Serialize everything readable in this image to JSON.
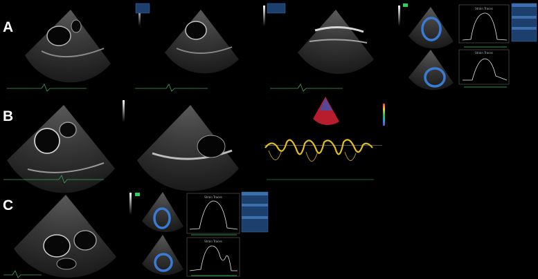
{
  "panel_labels": {
    "a": "A",
    "b": "B",
    "c": "C"
  },
  "strain_titles": {
    "a_top": "Strain Traces",
    "a_bottom": "Strain Traces",
    "c_top": "Strain Traces",
    "c_bottom": "Strain Traces"
  }
}
